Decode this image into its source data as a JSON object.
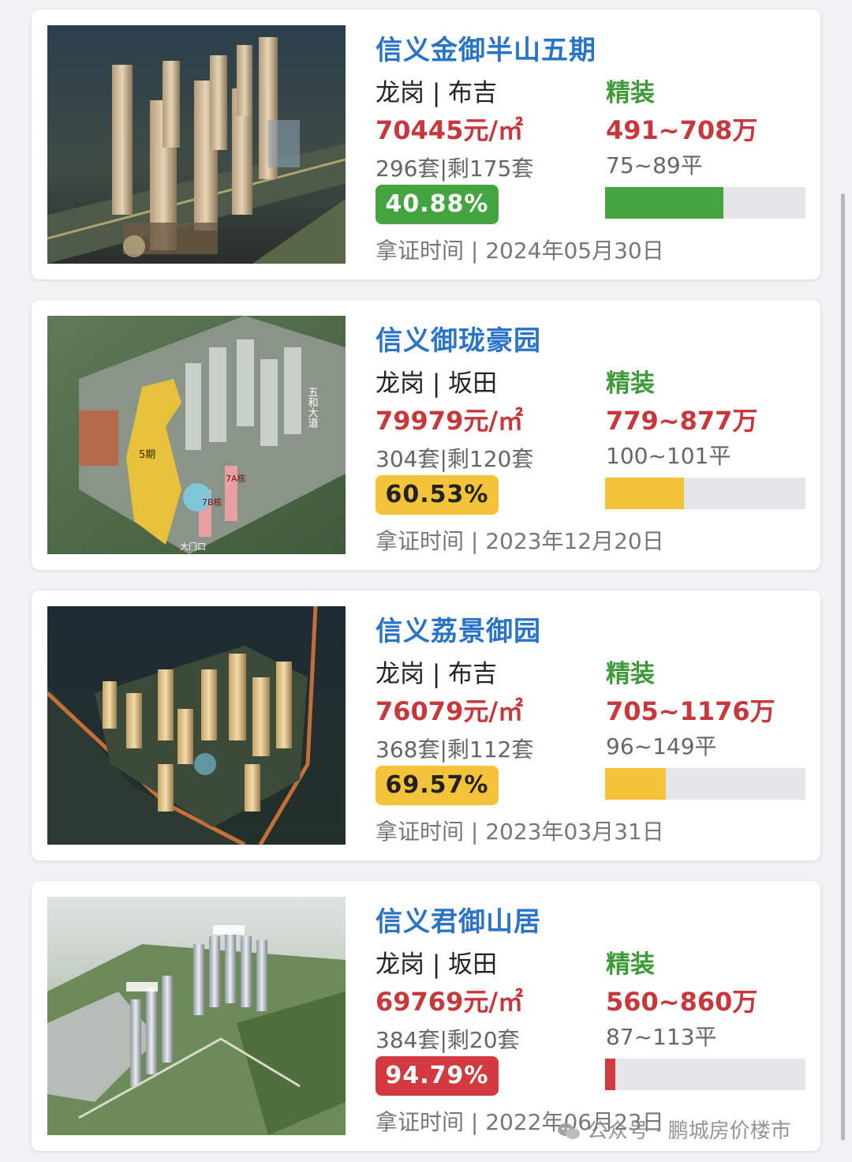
{
  "listings": [
    {
      "name": "信义金御半山五期",
      "location": "龙岗 | 布吉",
      "decoration": "精装",
      "unit_price": "70445元/㎡",
      "total_price": "491~708万",
      "units": "296套|剩175套",
      "area": "75~89平",
      "sold_pct_label": "40.88%",
      "sold_fraction": 0.4088,
      "status_color": "#43a440",
      "cert_date": "拿证时间 | 2024年05月30日",
      "photo_icon": "night-aerial-towers-image"
    },
    {
      "name": "信义御珑豪园",
      "location": "龙岗 | 坂田",
      "decoration": "精装",
      "unit_price": "79979元/㎡",
      "total_price": "779~877万",
      "units": "304套|剩120套",
      "area": "100~101平",
      "sold_pct_label": "60.53%",
      "sold_fraction": 0.6053,
      "status_color": "#f4c33a",
      "cert_date": "拿证时间 | 2023年12月20日",
      "photo_icon": "site-plan-aerial-image",
      "photo_labels": [
        "五和大道",
        "5期",
        "7A栋",
        "7B栋",
        "大门口"
      ]
    },
    {
      "name": "信义荔景御园",
      "location": "龙岗 | 布吉",
      "decoration": "精装",
      "unit_price": "76079元/㎡",
      "total_price": "705~1176万",
      "units": "368套|剩112套",
      "area": "96~149平",
      "sold_pct_label": "69.57%",
      "sold_fraction": 0.6957,
      "status_color": "#f4c33a",
      "cert_date": "拿证时间 | 2023年03月31日",
      "photo_icon": "night-aerial-complex-image"
    },
    {
      "name": "信义君御山居",
      "location": "龙岗 | 坂田",
      "decoration": "精装",
      "unit_price": "69769元/㎡",
      "total_price": "560~860万",
      "units": "384套|剩20套",
      "area": "87~113平",
      "sold_pct_label": "94.79%",
      "sold_fraction": 0.9479,
      "status_color": "#d23a40",
      "cert_date": "拿证时间 | 2022年06月23日",
      "photo_icon": "day-aerial-forest-image"
    }
  ],
  "watermark": {
    "text": "公众号 · 鹏城房价楼市",
    "icon": "wechat-icon"
  },
  "colors": {
    "title": "#2a74c8",
    "price": "#c8373c",
    "decoration": "#3e9a3a",
    "bar_track": "#e6e6ea",
    "badge_text_dark": "#222222",
    "badge_text_light": "#ffffff"
  }
}
